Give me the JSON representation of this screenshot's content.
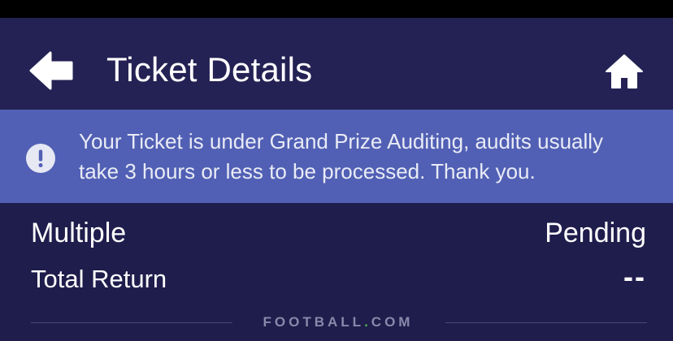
{
  "header": {
    "back_icon": "arrow-left-icon",
    "title": "Ticket Details",
    "home_icon": "home-icon"
  },
  "banner": {
    "icon": "exclamation-circle-icon",
    "message_line1": "Your Ticket is under Grand Prize Auditing, audits usually",
    "message_line2": "take 3 hours or less to be processed. Thank you."
  },
  "ticket": {
    "type": "Multiple",
    "status": "Pending",
    "total_return_label": "Total Return",
    "total_return_value": "--"
  },
  "watermark": {
    "part1": "FOOTBALL",
    "dot": ".",
    "part2": "COM"
  },
  "colors": {
    "background": "#1f1d4c",
    "header": "#242254",
    "banner": "#5160b4",
    "text": "#ffffff"
  }
}
